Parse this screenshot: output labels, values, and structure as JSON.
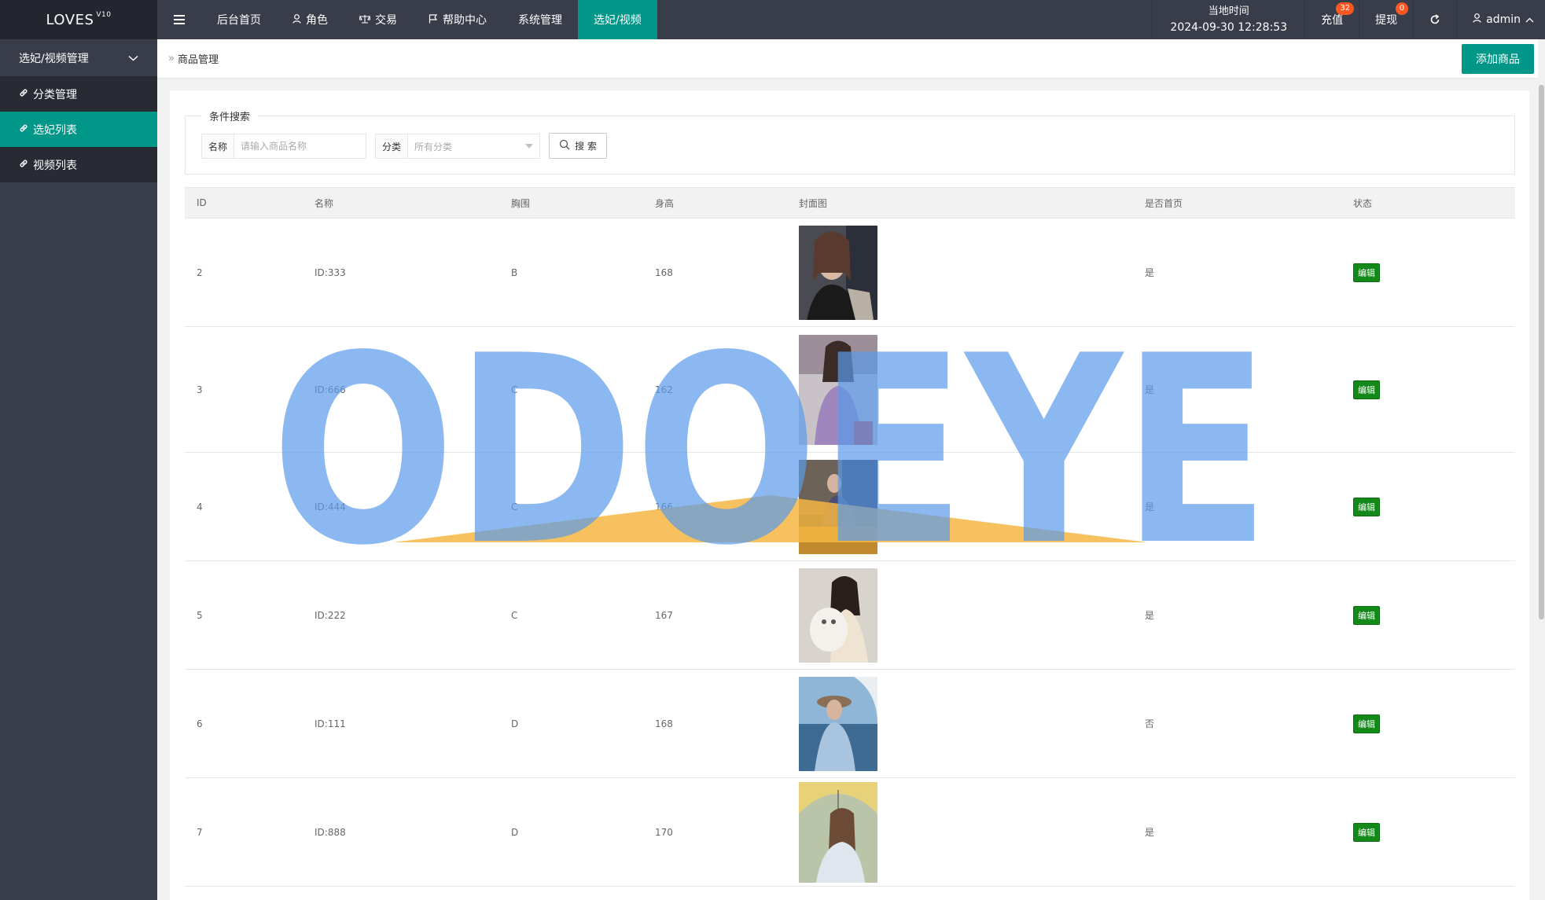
{
  "header": {
    "logo": "LOVES",
    "logo_version": "V10",
    "nav": [
      {
        "label": "后台首页",
        "icon": ""
      },
      {
        "label": "角色",
        "icon": "user-icon"
      },
      {
        "label": "交易",
        "icon": "scale-icon"
      },
      {
        "label": "帮助中心",
        "icon": "flag-icon"
      },
      {
        "label": "系统管理",
        "icon": ""
      },
      {
        "label": "选妃/视频",
        "icon": "",
        "active": true
      }
    ],
    "time_label": "当地时间",
    "time_value": "2024-09-30 12:28:53",
    "recharge_label": "充值",
    "recharge_badge": "32",
    "withdraw_label": "提现",
    "withdraw_badge": "0",
    "user": "admin"
  },
  "sidebar": {
    "group": "选妃/视频管理",
    "items": [
      {
        "label": "分类管理"
      },
      {
        "label": "选妃列表",
        "active": true
      },
      {
        "label": "视频列表"
      }
    ]
  },
  "breadcrumb": "商品管理",
  "add_button": "添加商品",
  "search": {
    "legend": "条件搜索",
    "name_label": "名称",
    "name_placeholder": "请输入商品名称",
    "category_label": "分类",
    "category_value": "所有分类",
    "button": "搜 索"
  },
  "table": {
    "headers": [
      "ID",
      "名称",
      "胸围",
      "身高",
      "封面图",
      "是否首页",
      "状态"
    ],
    "rows": [
      {
        "id": "2",
        "name": "ID:333",
        "bust": "B",
        "height": "168",
        "home": "是",
        "status": "编辑"
      },
      {
        "id": "3",
        "name": "ID:666",
        "bust": "C",
        "height": "162",
        "home": "是",
        "status": "编辑"
      },
      {
        "id": "4",
        "name": "ID:444",
        "bust": "C",
        "height": "166",
        "home": "是",
        "status": "编辑"
      },
      {
        "id": "5",
        "name": "ID:222",
        "bust": "C",
        "height": "167",
        "home": "是",
        "status": "编辑"
      },
      {
        "id": "6",
        "name": "ID:111",
        "bust": "D",
        "height": "168",
        "home": "否",
        "status": "编辑"
      },
      {
        "id": "7",
        "name": "ID:888",
        "bust": "D",
        "height": "170",
        "home": "是",
        "status": "编辑"
      }
    ]
  },
  "watermark": "ODOEYE",
  "colors": {
    "accent": "#009688",
    "header": "#393d49",
    "edit": "#13891a",
    "badge": "#ff5722",
    "watermark_blue": "#5b9bea",
    "watermark_orange": "#f5b642"
  }
}
